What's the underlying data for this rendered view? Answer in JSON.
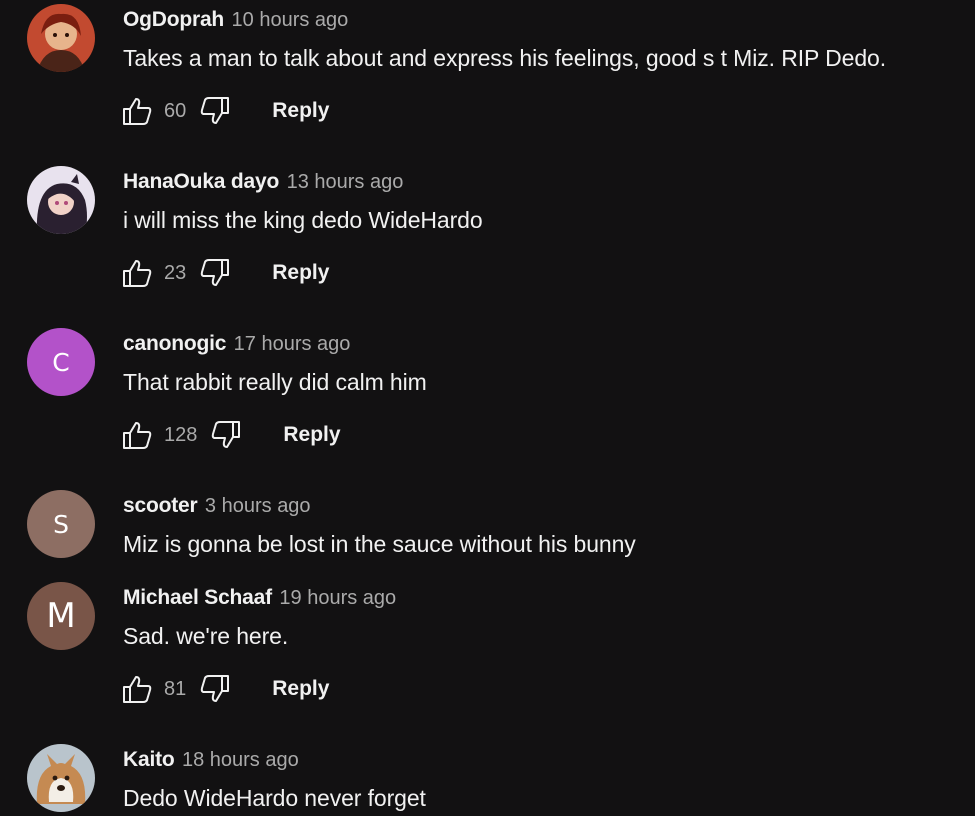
{
  "comments": [
    {
      "author": "OgDoprah",
      "time": "10 hours ago",
      "text": "Takes a man to talk about and express his feelings, good s    t Miz. RIP Dedo.",
      "likes": "60",
      "reply": "Reply",
      "avatar": {
        "type": "image",
        "icon": "anime-avatar-red",
        "color": "#b8402a"
      }
    },
    {
      "author": "HanaOuka dayo",
      "time": "13 hours ago",
      "text": "i will miss the king dedo WideHardo",
      "likes": "23",
      "reply": "Reply",
      "avatar": {
        "type": "image",
        "icon": "anime-avatar-purple",
        "color": "#6b5a8c"
      }
    },
    {
      "author": "canonogic",
      "time": "17 hours ago",
      "text": "That rabbit really did calm him",
      "likes": "128",
      "reply": "Reply",
      "avatar": {
        "type": "letter",
        "letter": "C",
        "color": "#b352c9"
      }
    },
    {
      "author": "scooter",
      "time": "3 hours ago",
      "text": "Miz is gonna be lost in the sauce without his bunny",
      "avatar": {
        "type": "letter",
        "letter": "S",
        "color": "#8d6e63"
      }
    },
    {
      "author": "Michael Schaaf",
      "time": "19 hours ago",
      "text": "Sad. we're here.",
      "likes": "81",
      "reply": "Reply",
      "avatar": {
        "type": "letter",
        "letter": "M",
        "color": "#795548"
      }
    },
    {
      "author": "Kaito",
      "time": "18 hours ago",
      "text": "Dedo WideHardo never forget",
      "avatar": {
        "type": "image",
        "icon": "dog-avatar",
        "color": "#c9a27a"
      }
    }
  ],
  "colors": {
    "background": "#121112",
    "primary_text": "#f1f1f1",
    "secondary_text": "#aaaaaa"
  }
}
